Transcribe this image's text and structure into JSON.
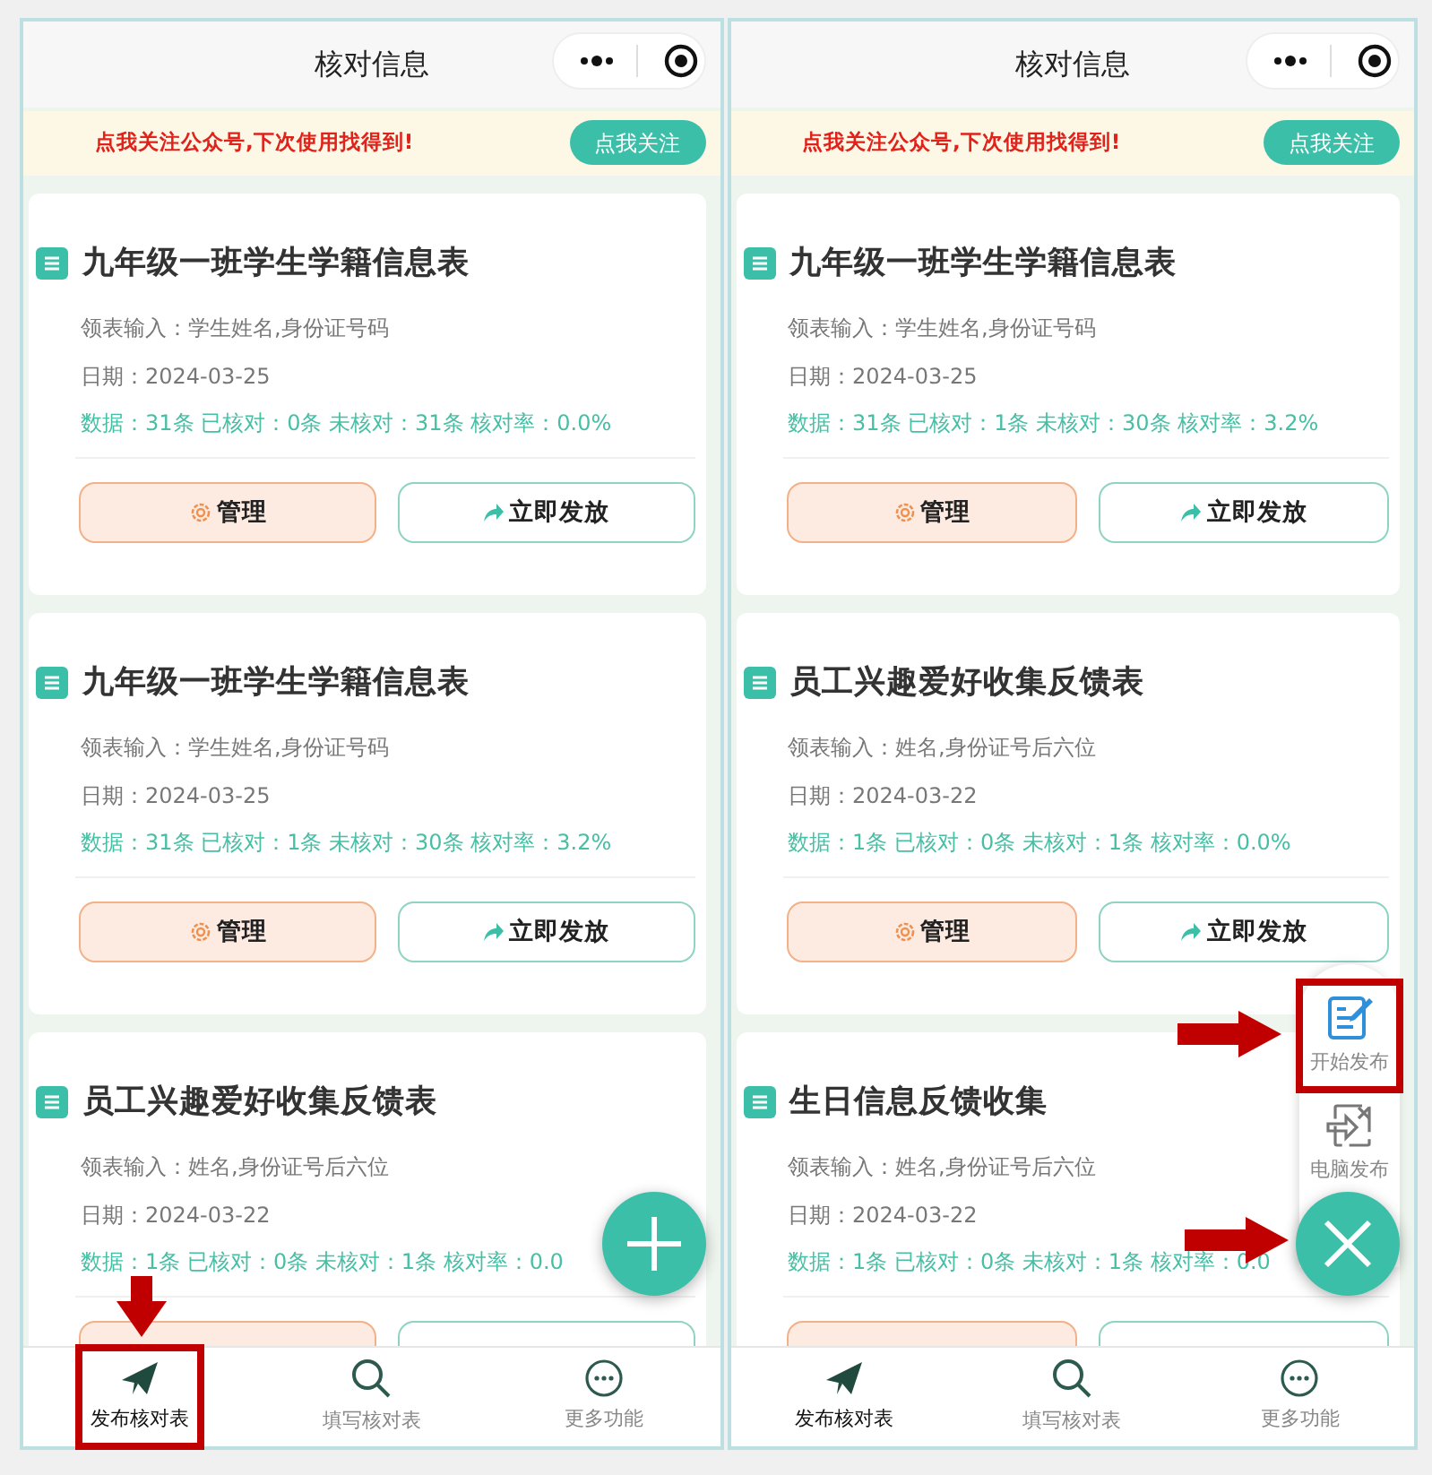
{
  "phones": [
    {
      "header": {
        "title": "核对信息"
      },
      "banner": {
        "text": "点我关注公众号,下次使用找得到!",
        "button": "点我关注"
      },
      "cards": [
        {
          "title": "九年级一班学生学籍信息表",
          "input": "领表输入：学生姓名,身份证号码",
          "date": "日期：2024-03-25",
          "stats": "数据：31条 已核对：0条 未核对：31条 核对率：0.0%",
          "buttons": [
            {
              "kind": "manage",
              "label": "管理"
            },
            {
              "kind": "publish",
              "label": "立即发放"
            }
          ]
        },
        {
          "title": "九年级一班学生学籍信息表",
          "input": "领表输入：学生姓名,身份证号码",
          "date": "日期：2024-03-25",
          "stats": "数据：31条 已核对：1条 未核对：30条 核对率：3.2%",
          "buttons": [
            {
              "kind": "manage",
              "label": "管理"
            },
            {
              "kind": "publish",
              "label": "立即发放"
            }
          ]
        },
        {
          "title": "员工兴趣爱好收集反馈表",
          "input": "领表输入：姓名,身份证号后六位",
          "date": "日期：2024-03-22",
          "stats": "数据：1条 已核对：0条 未核对：1条 核对率：0.0",
          "buttons": [
            {
              "kind": "manage"
            },
            {
              "kind": "publish"
            }
          ]
        }
      ],
      "fab": {
        "expanded": false,
        "pointed": false
      },
      "nav": [
        {
          "kind": "send",
          "label": "发布核对表",
          "selected": true,
          "highlighted": true,
          "pointed": true
        },
        {
          "kind": "search",
          "label": "填写核对表",
          "selected": false,
          "highlighted": false,
          "pointed": false
        },
        {
          "kind": "more",
          "label": "更多功能",
          "selected": false,
          "highlighted": false,
          "pointed": false
        }
      ]
    },
    {
      "header": {
        "title": "核对信息"
      },
      "banner": {
        "text": "点我关注公众号,下次使用找得到!",
        "button": "点我关注"
      },
      "cards": [
        {
          "title": "九年级一班学生学籍信息表",
          "input": "领表输入：学生姓名,身份证号码",
          "date": "日期：2024-03-25",
          "stats": "数据：31条 已核对：1条 未核对：30条 核对率：3.2%",
          "buttons": [
            {
              "kind": "manage",
              "label": "管理"
            },
            {
              "kind": "publish",
              "label": "立即发放"
            }
          ]
        },
        {
          "title": "员工兴趣爱好收集反馈表",
          "input": "领表输入：姓名,身份证号后六位",
          "date": "日期：2024-03-22",
          "stats": "数据：1条 已核对：0条 未核对：1条 核对率：0.0%",
          "buttons": [
            {
              "kind": "manage",
              "label": "管理"
            },
            {
              "kind": "publish",
              "label": "立即发放"
            }
          ]
        },
        {
          "title": "生日信息反馈收集",
          "input": "领表输入：姓名,身份证号后六位",
          "date": "日期：2024-03-22",
          "stats": "数据：1条 已核对：0条 未核对：1条 核对率：0.0",
          "buttons": [
            {
              "kind": "manage"
            },
            {
              "kind": "publish"
            }
          ]
        }
      ],
      "fab": {
        "expanded": true,
        "pointed": true,
        "menu": [
          {
            "kind": "edit",
            "label": "开始发布",
            "highlighted": true,
            "pointed": true
          },
          {
            "kind": "pc",
            "label": "电脑发布",
            "highlighted": false,
            "pointed": false
          }
        ]
      },
      "nav": [
        {
          "kind": "send",
          "label": "发布核对表",
          "selected": true,
          "highlighted": false,
          "pointed": false
        },
        {
          "kind": "search",
          "label": "填写核对表",
          "selected": false,
          "highlighted": false,
          "pointed": false
        },
        {
          "kind": "more",
          "label": "更多功能",
          "selected": false,
          "highlighted": false,
          "pointed": false
        }
      ]
    }
  ]
}
